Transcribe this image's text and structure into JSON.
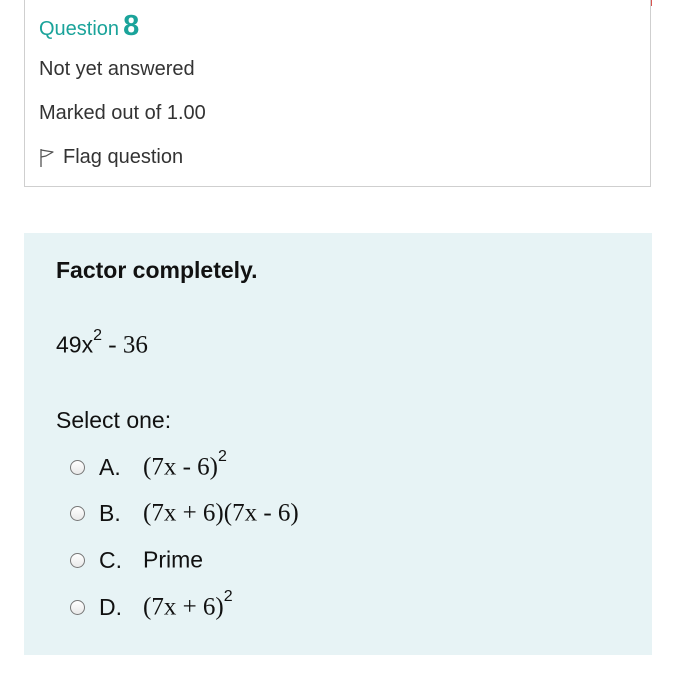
{
  "question": {
    "label": "Question",
    "number": "8",
    "status": "Not yet answered",
    "marks": "Marked out of 1.00",
    "flag_label": "Flag question"
  },
  "content": {
    "prompt": "Factor completely.",
    "expression": {
      "coef": "49x",
      "exp": "2",
      "rest": " - 36"
    },
    "select_label": "Select one:",
    "options": [
      {
        "letter": "A.",
        "text": "(7x - 6)",
        "exp": "2"
      },
      {
        "letter": "B.",
        "text": "(7x + 6)(7x - 6)",
        "exp": ""
      },
      {
        "letter": "C.",
        "text": "Prime",
        "exp": ""
      },
      {
        "letter": "D.",
        "text": "(7x + 6)",
        "exp": "2"
      }
    ]
  },
  "colors": {
    "accent": "#1aa39a",
    "panel": "#e7f3f5",
    "red_border": "#d9534f"
  }
}
